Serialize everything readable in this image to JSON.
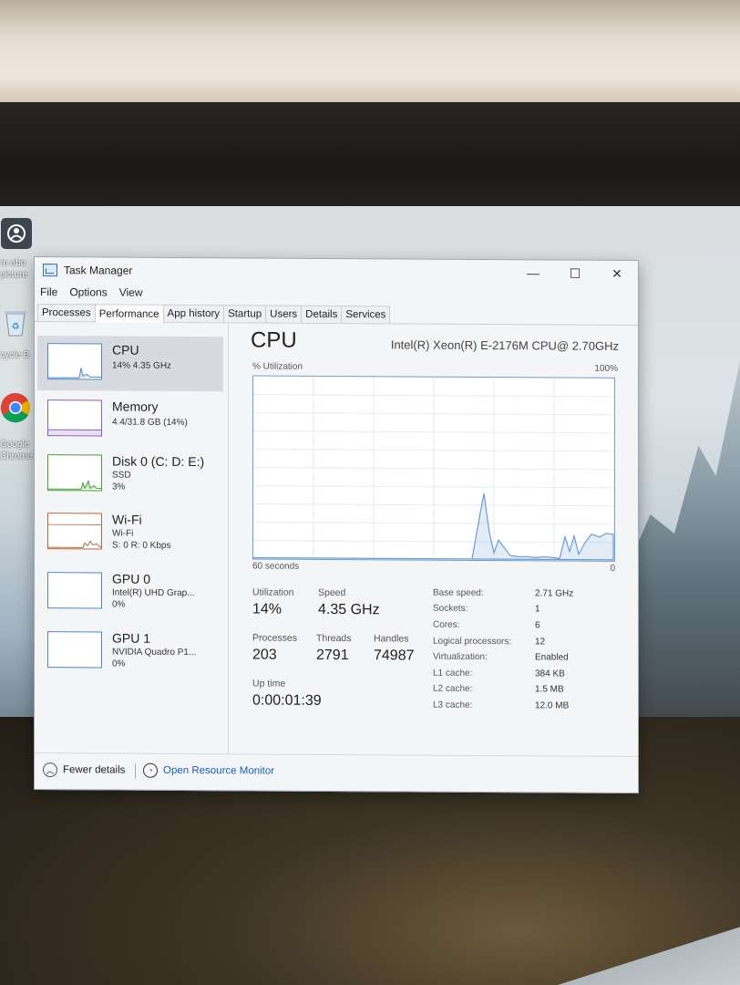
{
  "desktop": {
    "icons": [
      {
        "name": "user-icon",
        "label_lines": [
          "rn abo",
          "picture"
        ]
      },
      {
        "name": "recycle-bin-icon",
        "label_lines": [
          "cycle B"
        ]
      },
      {
        "name": "chrome-icon",
        "label_lines": [
          "Google",
          "Chrome"
        ]
      }
    ]
  },
  "window": {
    "title": "Task Manager",
    "controls": {
      "minimize": "—",
      "maximize": "☐",
      "close": "✕"
    },
    "menu": [
      "File",
      "Options",
      "View"
    ],
    "tabs": [
      "Processes",
      "Performance",
      "App history",
      "Startup",
      "Users",
      "Details",
      "Services"
    ],
    "active_tab": "Performance"
  },
  "sidebar": {
    "items": [
      {
        "name": "CPU",
        "lines": [
          "14% 4.35 GHz"
        ]
      },
      {
        "name": "Memory",
        "lines": [
          "4.4/31.8 GB (14%)"
        ]
      },
      {
        "name": "Disk 0 (C: D: E:)",
        "lines": [
          "SSD",
          "3%"
        ]
      },
      {
        "name": "Wi-Fi",
        "lines": [
          "Wi-Fi",
          "S: 0 R: 0 Kbps"
        ]
      },
      {
        "name": "GPU 0",
        "lines": [
          "Intel(R) UHD Grap...",
          "0%"
        ]
      },
      {
        "name": "GPU 1",
        "lines": [
          "NVIDIA Quadro P1...",
          "0%"
        ]
      }
    ],
    "selected": "CPU"
  },
  "cpu_panel": {
    "title": "CPU",
    "model": "Intel(R) Xeon(R) E-2176M CPU@ 2.70GHz",
    "graph": {
      "y_label": "% Utilization",
      "y_max_label": "100%",
      "x_left_label": "60 seconds",
      "x_right_label": "0"
    },
    "stats": {
      "utilization": {
        "label": "Utilization",
        "value": "14%"
      },
      "speed": {
        "label": "Speed",
        "value": "4.35 GHz"
      },
      "processes": {
        "label": "Processes",
        "value": "203"
      },
      "threads": {
        "label": "Threads",
        "value": "2791"
      },
      "handles": {
        "label": "Handles",
        "value": "74987"
      },
      "uptime": {
        "label": "Up time",
        "value": "0:00:01:39"
      }
    },
    "specs": [
      {
        "key": "Base speed:",
        "value": "2.71 GHz"
      },
      {
        "key": "Sockets:",
        "value": "1"
      },
      {
        "key": "Cores:",
        "value": "6"
      },
      {
        "key": "Logical processors:",
        "value": "12"
      },
      {
        "key": "Virtualization:",
        "value": "Enabled"
      },
      {
        "key": "L1 cache:",
        "value": "384 KB"
      },
      {
        "key": "L2 cache:",
        "value": "1.5 MB"
      },
      {
        "key": "L3 cache:",
        "value": "12.0 MB"
      }
    ]
  },
  "footer": {
    "fewer_details": "Fewer details",
    "open_resource_monitor": "Open Resource Monitor"
  },
  "colors": {
    "accent": "#1a5fb4",
    "graph_line": "#6c9bd2",
    "selected_bg": "#d7dbe1"
  }
}
